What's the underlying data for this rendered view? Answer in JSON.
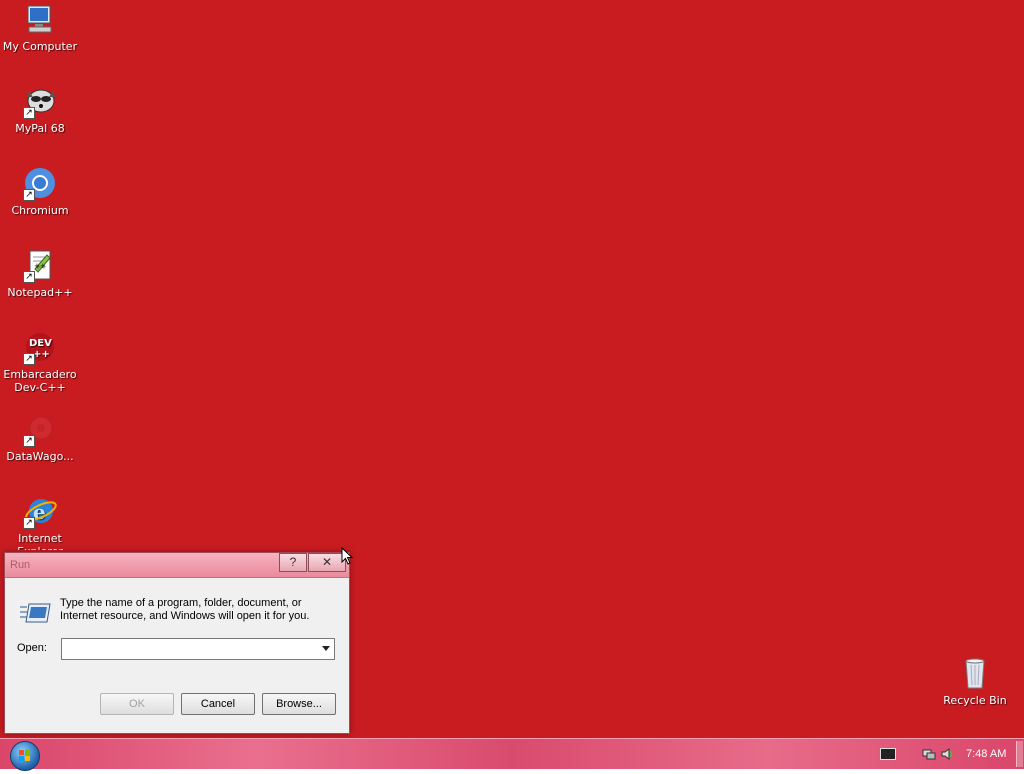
{
  "desktop": {
    "background_color": "#c91c21",
    "icons": [
      {
        "label": "My Computer",
        "icon": "computer-icon"
      },
      {
        "label": "MyPal 68",
        "icon": "mypal-icon"
      },
      {
        "label": "Chromium",
        "icon": "chromium-icon"
      },
      {
        "label": "Notepad++",
        "icon": "notepad-plus-plus-icon"
      },
      {
        "label": "Embarcadero Dev-C++",
        "icon": "devcpp-icon"
      },
      {
        "label": "DataWago...",
        "icon": "datawagon-icon"
      },
      {
        "label": "Internet Explorer",
        "icon": "internet-explorer-icon"
      },
      {
        "label": "Recycle Bin",
        "icon": "recycle-bin-icon"
      }
    ]
  },
  "run_dialog": {
    "title": "Run",
    "help_label": "?",
    "close_label": "✕",
    "description": "Type the name of a program, folder, document, or Internet resource, and Windows will open it for you.",
    "open_label": "Open:",
    "open_value": "",
    "ok_label": "OK",
    "cancel_label": "Cancel",
    "browse_label": "Browse..."
  },
  "taskbar": {
    "clock": "7:48 AM"
  }
}
